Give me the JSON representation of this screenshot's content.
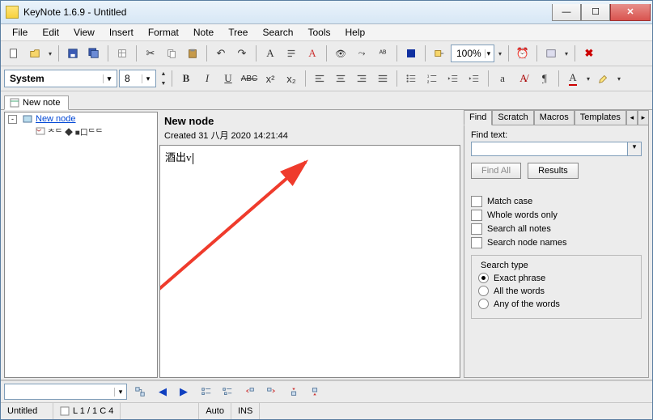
{
  "title": "KeyNote 1.6.9 - Untitled",
  "menu": [
    "File",
    "Edit",
    "View",
    "Insert",
    "Format",
    "Note",
    "Tree",
    "Search",
    "Tools",
    "Help"
  ],
  "toolbar1": {
    "zoom": "100%"
  },
  "toolbar2": {
    "font_name": "System",
    "font_size": "8",
    "B": "B",
    "I": "I",
    "U": "U",
    "S": "ABC",
    "sup": "x²",
    "sub": "x₂",
    "A": "A"
  },
  "note_tab": {
    "label": "New note"
  },
  "tree": {
    "root": "New node",
    "child": "ᄎᄃ ◆ ■口ᄃᄃ"
  },
  "editor": {
    "heading": "New node",
    "created": "Created 31 八月 2020 14:21:44",
    "body": "酒出v"
  },
  "side": {
    "tabs": [
      "Find",
      "Scratch",
      "Macros",
      "Templates"
    ],
    "find_label": "Find text:",
    "find_value": "",
    "findall": "Find All",
    "results": "Results",
    "checks": {
      "match_case": "Match case",
      "whole_words": "Whole words only",
      "search_all_notes": "Search all notes",
      "search_node_names": "Search node names"
    },
    "search_type_legend": "Search type",
    "radios": {
      "exact": "Exact phrase",
      "all": "All the words",
      "any": "Any of the words"
    }
  },
  "bottom_combo": "",
  "status": {
    "doc": "Untitled",
    "pos": "L 1 / 1  C 4",
    "auto": "Auto",
    "ins": "INS"
  }
}
